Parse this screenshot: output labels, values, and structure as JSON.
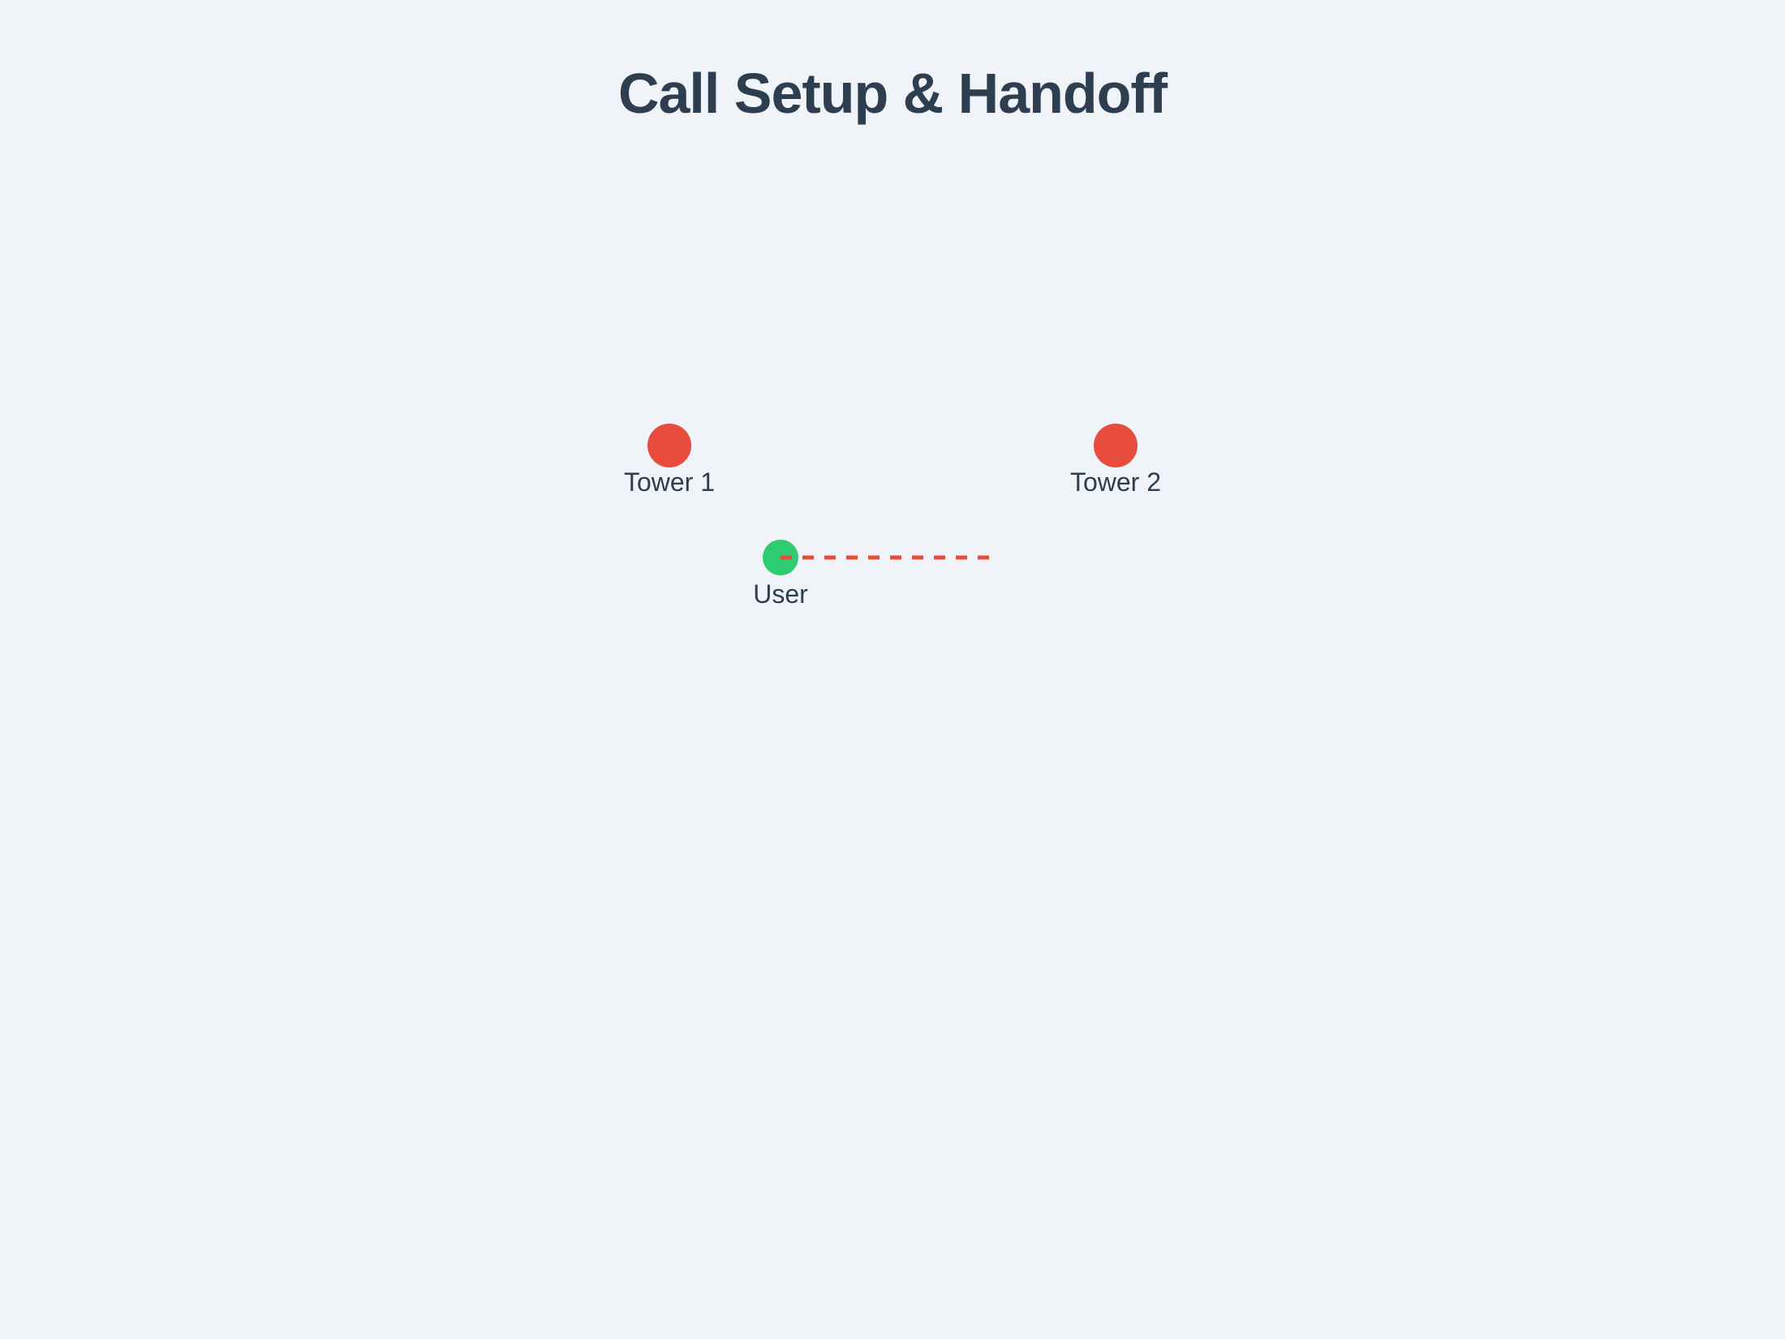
{
  "title": "Call Setup & Handoff",
  "nodes": [
    {
      "id": "tower1",
      "label": "Tower 1",
      "type": "tower",
      "color": "#e74c3c"
    },
    {
      "id": "tower2",
      "label": "Tower 2",
      "type": "tower",
      "color": "#e74c3c"
    },
    {
      "id": "user",
      "label": "User",
      "type": "user",
      "color": "#2ecc71"
    }
  ],
  "links": [
    {
      "from": "user",
      "toward": "tower2",
      "style": "dashed",
      "color": "#e74c3c"
    }
  ],
  "colors": {
    "background": "#f0f4f8",
    "text": "#2c3e50",
    "tower": "#e74c3c",
    "user": "#2ecc71",
    "signal": "#e74c3c"
  }
}
